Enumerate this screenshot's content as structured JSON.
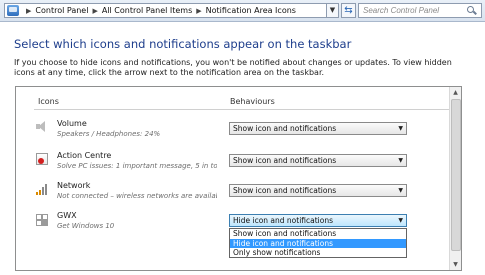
{
  "address_bar": {
    "crumbs": [
      "Control Panel",
      "All Control Panel Items",
      "Notification Area Icons"
    ],
    "search_placeholder": "Search Control Panel"
  },
  "page": {
    "heading": "Select which icons and notifications appear on the taskbar",
    "intro": "If you choose to hide icons and notifications, you won't be notified about changes or updates. To view hidden icons at any time, click the arrow next to the notification area on the taskbar."
  },
  "list": {
    "col_icons": "Icons",
    "col_behaviours": "Behaviours",
    "rows": [
      {
        "name": "Volume",
        "desc": "Speakers / Headphones: 24%",
        "icon": "speaker-icon",
        "behaviour": "Show icon and notifications"
      },
      {
        "name": "Action Centre",
        "desc": "Solve PC issues: 1 important message, 5 in total...",
        "icon": "action-centre-flag-icon",
        "behaviour": "Show icon and notifications"
      },
      {
        "name": "Network",
        "desc": "Not connected – wireless networks are available.",
        "icon": "network-signal-icon",
        "behaviour": "Show icon and notifications"
      },
      {
        "name": "GWX",
        "desc": "Get Windows 10",
        "icon": "windows-logo-icon",
        "behaviour": "Hide icon and notifications"
      }
    ],
    "dropdown_options": [
      "Show icon and notifications",
      "Hide icon and notifications",
      "Only show notifications"
    ],
    "dropdown_selected_index": 1
  },
  "colors": {
    "heading": "#1e3e8c",
    "selection": "#3399ff"
  }
}
